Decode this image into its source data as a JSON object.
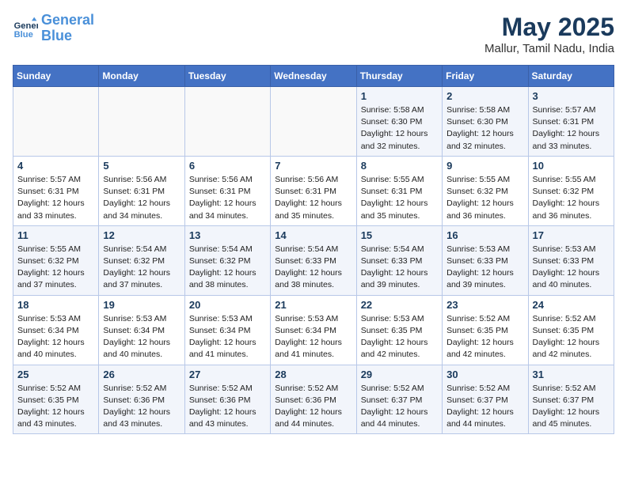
{
  "header": {
    "logo_line1": "General",
    "logo_line2": "Blue",
    "month": "May 2025",
    "location": "Mallur, Tamil Nadu, India"
  },
  "weekdays": [
    "Sunday",
    "Monday",
    "Tuesday",
    "Wednesday",
    "Thursday",
    "Friday",
    "Saturday"
  ],
  "weeks": [
    [
      {
        "day": "",
        "info": ""
      },
      {
        "day": "",
        "info": ""
      },
      {
        "day": "",
        "info": ""
      },
      {
        "day": "",
        "info": ""
      },
      {
        "day": "1",
        "info": "Sunrise: 5:58 AM\nSunset: 6:30 PM\nDaylight: 12 hours\nand 32 minutes."
      },
      {
        "day": "2",
        "info": "Sunrise: 5:58 AM\nSunset: 6:30 PM\nDaylight: 12 hours\nand 32 minutes."
      },
      {
        "day": "3",
        "info": "Sunrise: 5:57 AM\nSunset: 6:31 PM\nDaylight: 12 hours\nand 33 minutes."
      }
    ],
    [
      {
        "day": "4",
        "info": "Sunrise: 5:57 AM\nSunset: 6:31 PM\nDaylight: 12 hours\nand 33 minutes."
      },
      {
        "day": "5",
        "info": "Sunrise: 5:56 AM\nSunset: 6:31 PM\nDaylight: 12 hours\nand 34 minutes."
      },
      {
        "day": "6",
        "info": "Sunrise: 5:56 AM\nSunset: 6:31 PM\nDaylight: 12 hours\nand 34 minutes."
      },
      {
        "day": "7",
        "info": "Sunrise: 5:56 AM\nSunset: 6:31 PM\nDaylight: 12 hours\nand 35 minutes."
      },
      {
        "day": "8",
        "info": "Sunrise: 5:55 AM\nSunset: 6:31 PM\nDaylight: 12 hours\nand 35 minutes."
      },
      {
        "day": "9",
        "info": "Sunrise: 5:55 AM\nSunset: 6:32 PM\nDaylight: 12 hours\nand 36 minutes."
      },
      {
        "day": "10",
        "info": "Sunrise: 5:55 AM\nSunset: 6:32 PM\nDaylight: 12 hours\nand 36 minutes."
      }
    ],
    [
      {
        "day": "11",
        "info": "Sunrise: 5:55 AM\nSunset: 6:32 PM\nDaylight: 12 hours\nand 37 minutes."
      },
      {
        "day": "12",
        "info": "Sunrise: 5:54 AM\nSunset: 6:32 PM\nDaylight: 12 hours\nand 37 minutes."
      },
      {
        "day": "13",
        "info": "Sunrise: 5:54 AM\nSunset: 6:32 PM\nDaylight: 12 hours\nand 38 minutes."
      },
      {
        "day": "14",
        "info": "Sunrise: 5:54 AM\nSunset: 6:33 PM\nDaylight: 12 hours\nand 38 minutes."
      },
      {
        "day": "15",
        "info": "Sunrise: 5:54 AM\nSunset: 6:33 PM\nDaylight: 12 hours\nand 39 minutes."
      },
      {
        "day": "16",
        "info": "Sunrise: 5:53 AM\nSunset: 6:33 PM\nDaylight: 12 hours\nand 39 minutes."
      },
      {
        "day": "17",
        "info": "Sunrise: 5:53 AM\nSunset: 6:33 PM\nDaylight: 12 hours\nand 40 minutes."
      }
    ],
    [
      {
        "day": "18",
        "info": "Sunrise: 5:53 AM\nSunset: 6:34 PM\nDaylight: 12 hours\nand 40 minutes."
      },
      {
        "day": "19",
        "info": "Sunrise: 5:53 AM\nSunset: 6:34 PM\nDaylight: 12 hours\nand 40 minutes."
      },
      {
        "day": "20",
        "info": "Sunrise: 5:53 AM\nSunset: 6:34 PM\nDaylight: 12 hours\nand 41 minutes."
      },
      {
        "day": "21",
        "info": "Sunrise: 5:53 AM\nSunset: 6:34 PM\nDaylight: 12 hours\nand 41 minutes."
      },
      {
        "day": "22",
        "info": "Sunrise: 5:53 AM\nSunset: 6:35 PM\nDaylight: 12 hours\nand 42 minutes."
      },
      {
        "day": "23",
        "info": "Sunrise: 5:52 AM\nSunset: 6:35 PM\nDaylight: 12 hours\nand 42 minutes."
      },
      {
        "day": "24",
        "info": "Sunrise: 5:52 AM\nSunset: 6:35 PM\nDaylight: 12 hours\nand 42 minutes."
      }
    ],
    [
      {
        "day": "25",
        "info": "Sunrise: 5:52 AM\nSunset: 6:35 PM\nDaylight: 12 hours\nand 43 minutes."
      },
      {
        "day": "26",
        "info": "Sunrise: 5:52 AM\nSunset: 6:36 PM\nDaylight: 12 hours\nand 43 minutes."
      },
      {
        "day": "27",
        "info": "Sunrise: 5:52 AM\nSunset: 6:36 PM\nDaylight: 12 hours\nand 43 minutes."
      },
      {
        "day": "28",
        "info": "Sunrise: 5:52 AM\nSunset: 6:36 PM\nDaylight: 12 hours\nand 44 minutes."
      },
      {
        "day": "29",
        "info": "Sunrise: 5:52 AM\nSunset: 6:37 PM\nDaylight: 12 hours\nand 44 minutes."
      },
      {
        "day": "30",
        "info": "Sunrise: 5:52 AM\nSunset: 6:37 PM\nDaylight: 12 hours\nand 44 minutes."
      },
      {
        "day": "31",
        "info": "Sunrise: 5:52 AM\nSunset: 6:37 PM\nDaylight: 12 hours\nand 45 minutes."
      }
    ]
  ]
}
